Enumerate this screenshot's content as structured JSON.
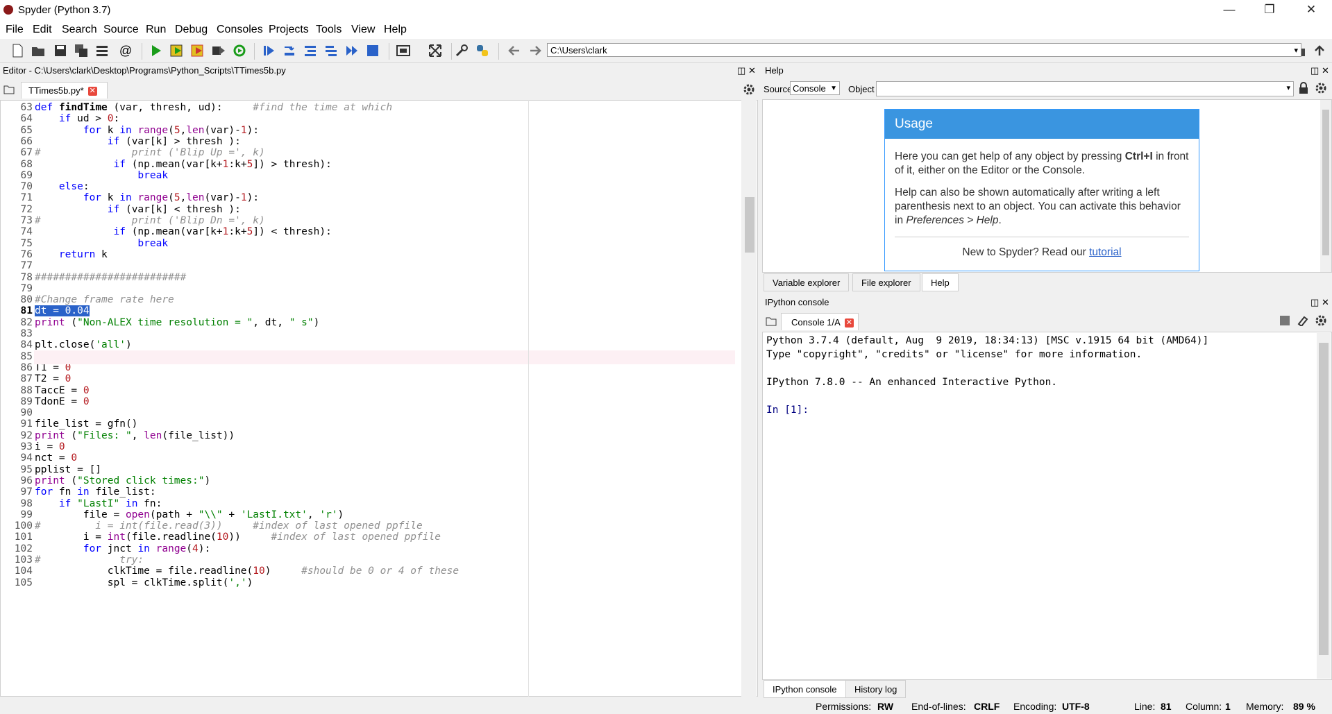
{
  "window": {
    "title": "Spyder (Python 3.7)"
  },
  "menu": [
    "File",
    "Edit",
    "Search",
    "Source",
    "Run",
    "Debug",
    "Consoles",
    "Projects",
    "Tools",
    "View",
    "Help"
  ],
  "toolbar": {
    "path": "C:\\Users\\clark"
  },
  "editor": {
    "header": "Editor - C:\\Users\\clark\\Desktop\\Programs\\Python_Scripts\\TTimes5b.py",
    "tab_label": "TTimes5b.py*",
    "lines": [
      {
        "n": "63",
        "code": "def findTime (var, thresh, ud):     #find the time at which"
      },
      {
        "n": "64",
        "code": "    if ud > 0:"
      },
      {
        "n": "65",
        "code": "        for k in range(5,len(var)-1):"
      },
      {
        "n": "66",
        "code": "            if (var[k] > thresh ):"
      },
      {
        "n": "67",
        "code": "#               print ('Blip Up =', k)"
      },
      {
        "n": "68",
        "code": "             if (np.mean(var[k+1:k+5]) > thresh):"
      },
      {
        "n": "69",
        "code": "                 break"
      },
      {
        "n": "70",
        "code": "    else:"
      },
      {
        "n": "71",
        "code": "        for k in range(5,len(var)-1):"
      },
      {
        "n": "72",
        "code": "            if (var[k] < thresh ):"
      },
      {
        "n": "73",
        "code": "#               print ('Blip Dn =', k)"
      },
      {
        "n": "74",
        "code": "             if (np.mean(var[k+1:k+5]) < thresh):"
      },
      {
        "n": "75",
        "code": "                 break"
      },
      {
        "n": "76",
        "code": "    return k"
      },
      {
        "n": "77",
        "code": ""
      },
      {
        "n": "78",
        "code": "#########################"
      },
      {
        "n": "79",
        "code": ""
      },
      {
        "n": "80",
        "code": "#Change frame rate here"
      },
      {
        "n": "81",
        "code": "dt = 0.04"
      },
      {
        "n": "82",
        "code": "print (\"Non-ALEX time resolution = \", dt, \" s\")"
      },
      {
        "n": "83",
        "code": ""
      },
      {
        "n": "84",
        "code": "plt.close('all')"
      },
      {
        "n": "85",
        "code": ""
      },
      {
        "n": "86",
        "code": "T1 = 0"
      },
      {
        "n": "87",
        "code": "T2 = 0"
      },
      {
        "n": "88",
        "code": "TaccE = 0"
      },
      {
        "n": "89",
        "code": "TdonE = 0"
      },
      {
        "n": "90",
        "code": ""
      },
      {
        "n": "91",
        "code": "file_list = gfn()"
      },
      {
        "n": "92",
        "code": "print (\"Files: \", len(file_list))"
      },
      {
        "n": "93",
        "code": "i = 0"
      },
      {
        "n": "94",
        "code": "nct = 0"
      },
      {
        "n": "95",
        "code": "pplist = []"
      },
      {
        "n": "96",
        "code": "print (\"Stored click times:\")"
      },
      {
        "n": "97",
        "code": "for fn in file_list:"
      },
      {
        "n": "98",
        "code": "    if \"LastI\" in fn:"
      },
      {
        "n": "99",
        "code": "        file = open(path + \"\\\\\" + 'LastI.txt', 'r')"
      },
      {
        "n": "100",
        "code": "#         i = int(file.read(3))     #index of last opened ppfile"
      },
      {
        "n": "101",
        "code": "        i = int(file.readline(10))     #index of last opened ppfile"
      },
      {
        "n": "102",
        "code": "        for jnct in range(4):"
      },
      {
        "n": "103",
        "code": "#             try:"
      },
      {
        "n": "104",
        "code": "            clkTime = file.readline(10)     #should be 0 or 4 of these"
      },
      {
        "n": "105",
        "code": "            spl = clkTime.split(',')"
      }
    ]
  },
  "help": {
    "header": "Help",
    "source_label": "Source",
    "source_value": "Console",
    "object_label": "Object",
    "usage_title": "Usage",
    "usage_p1a": "Here you can get help of any object by pressing ",
    "usage_p1b": "Ctrl+I",
    "usage_p1c": " in front of it, either on the Editor or the Console.",
    "usage_p2a": "Help can also be shown automatically after writing a left parenthesis next to an object. You can activate this behavior in ",
    "usage_p2b": "Preferences > Help",
    "usage_p2c": ".",
    "usage_p3a": "New to Spyder? Read our ",
    "usage_link": "tutorial",
    "tabs": [
      "Variable explorer",
      "File explorer",
      "Help"
    ]
  },
  "console": {
    "header": "IPython console",
    "tab_label": "Console 1/A",
    "lines": [
      "Python 3.7.4 (default, Aug  9 2019, 18:34:13) [MSC v.1915 64 bit (AMD64)]",
      "Type \"copyright\", \"credits\" or \"license\" for more information.",
      "",
      "IPython 7.8.0 -- An enhanced Interactive Python.",
      "",
      "In [1]:"
    ],
    "bottom_tabs": [
      "IPython console",
      "History log"
    ]
  },
  "status": {
    "permissions_label": "Permissions:",
    "permissions": "RW",
    "eol_label": "End-of-lines:",
    "eol": "CRLF",
    "encoding_label": "Encoding:",
    "encoding": "UTF-8",
    "line_label": "Line:",
    "line": "81",
    "column_label": "Column:",
    "column": "1",
    "memory_label": "Memory:",
    "memory": "89 %"
  },
  "colors": {
    "accent": "#3a95e0",
    "keyword": "#0000ff",
    "string": "#008000",
    "number": "#b4181d",
    "comment": "#909090"
  }
}
